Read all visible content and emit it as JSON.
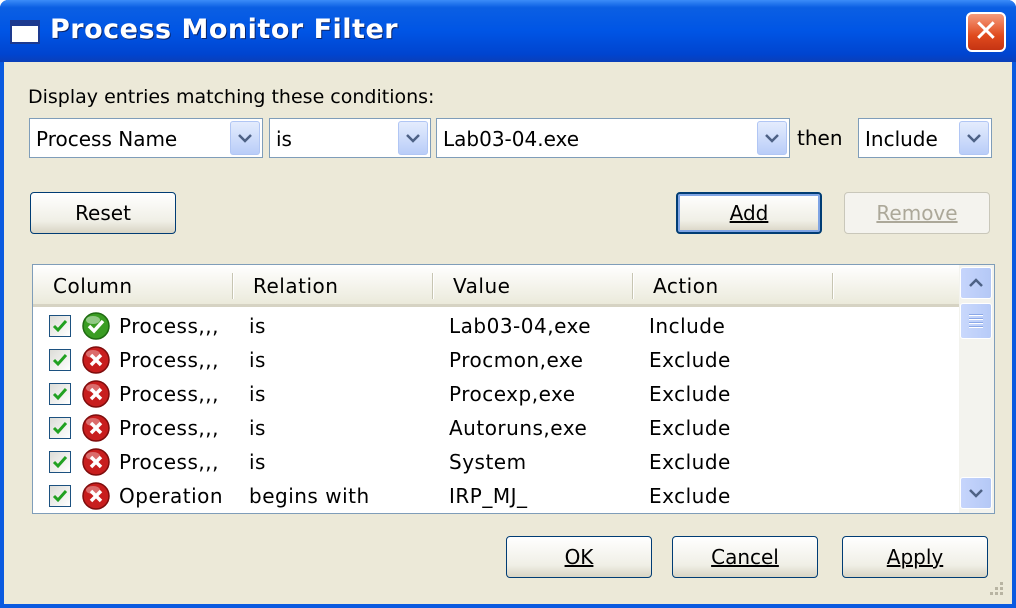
{
  "window": {
    "title": "Process Monitor Filter",
    "close_label": "✕"
  },
  "filter": {
    "prompt": "Display entries matching these conditions:",
    "column_value": "Process Name",
    "relation_value": "is",
    "value_value": "Lab03-04.exe",
    "then_label": "then",
    "action_value": "Include"
  },
  "buttons": {
    "reset": "Reset",
    "add": "Add",
    "remove": "Remove",
    "ok": "OK",
    "cancel": "Cancel",
    "apply": "Apply"
  },
  "list": {
    "headers": [
      "Column",
      "Relation",
      "Value",
      "Action"
    ],
    "rows": [
      {
        "checked": true,
        "status": "include",
        "column": "Process,,,",
        "relation": "is",
        "value": "Lab03-04,exe",
        "action": "Include"
      },
      {
        "checked": true,
        "status": "exclude",
        "column": "Process,,,",
        "relation": "is",
        "value": "Procmon,exe",
        "action": "Exclude"
      },
      {
        "checked": true,
        "status": "exclude",
        "column": "Process,,,",
        "relation": "is",
        "value": "Procexp,exe",
        "action": "Exclude"
      },
      {
        "checked": true,
        "status": "exclude",
        "column": "Process,,,",
        "relation": "is",
        "value": "Autoruns,exe",
        "action": "Exclude"
      },
      {
        "checked": true,
        "status": "exclude",
        "column": "Process,,,",
        "relation": "is",
        "value": "System",
        "action": "Exclude"
      },
      {
        "checked": true,
        "status": "exclude",
        "column": "Operation",
        "relation": "begins with",
        "value": "IRP_MJ_",
        "action": "Exclude"
      }
    ]
  },
  "colors": {
    "titlebar": "#0055e5",
    "include_icon": "#3a9d23",
    "exclude_icon": "#c81e1e",
    "dialog_bg": "#ece9d8"
  }
}
